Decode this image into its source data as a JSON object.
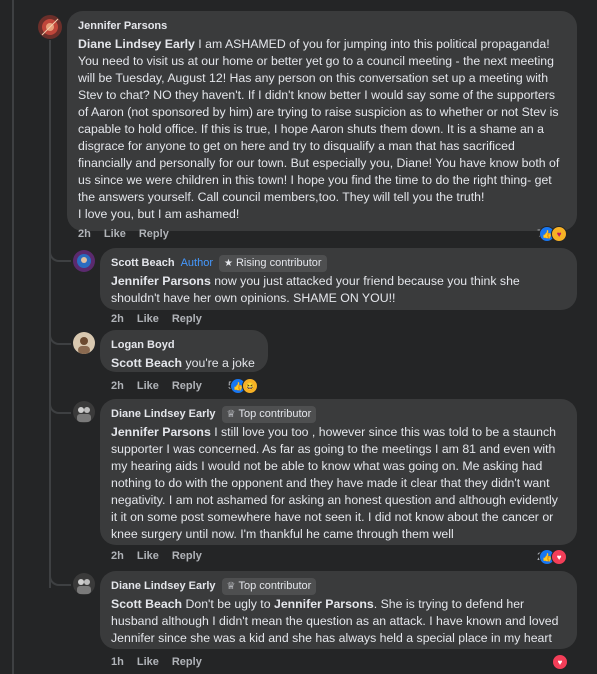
{
  "comments": [
    {
      "author": "Jennifer Parsons",
      "segments": [
        {
          "t": "Diane Lindsey Early",
          "m": true
        },
        {
          "t": " I am ASHAMED of you for jumping into this political propaganda! You need to visit us at our home or better yet go to a council meeting - the next meeting will be Tuesday, August 12! Has any person on this conversation set up a meeting with Stev to chat? NO they haven't. If I didn't know better I would say some of the supporters of Aaron (not sponsored by him) are trying to raise suspicion as to whether or not Stev is capable to hold office. If this is true, I hope Aaron shuts them down. It is a shame an a disgrace for anyone to get on here and try to disqualify a man that has sacrificed financially and personally for our town. But especially you, Diane! You have know both of us since we were children in this town! I hope you find the time to do the right thing- get the answers yourself. Call council members,too. They will tell you the truth!\nI love you, but I am ashamed!",
          "m": false
        }
      ],
      "time": "2h",
      "like": "Like",
      "reply": "Reply",
      "reaction_count": "7",
      "reactions": [
        "like",
        "care"
      ]
    },
    {
      "author": "Scott Beach",
      "author_tag": "Author",
      "badge": "Rising contributor",
      "badge_icon": "star-icon",
      "segments": [
        {
          "t": "Jennifer Parsons",
          "m": true
        },
        {
          "t": " now you just attacked your friend because you think she shouldn't have her own opinions. SHAME ON YOU!!",
          "m": false
        }
      ],
      "time": "2h",
      "like": "Like",
      "reply": "Reply"
    },
    {
      "author": "Logan Boyd",
      "segments": [
        {
          "t": "Scott Beach",
          "m": true
        },
        {
          "t": " you're a joke",
          "m": false
        }
      ],
      "time": "2h",
      "like": "Like",
      "reply": "Reply",
      "reaction_count": "5",
      "reactions": [
        "like",
        "haha"
      ]
    },
    {
      "author": "Diane Lindsey Early",
      "badge": "Top contributor",
      "badge_icon": "award-icon",
      "segments": [
        {
          "t": "Jennifer Parsons",
          "m": true
        },
        {
          "t": " I still love you too , however since this was told to be a staunch supporter I was concerned. As far as going to the meetings I am 81 and even with my hearing aids I would not be able to know what was going on. Me asking had nothing to do with the opponent and they have made it clear that they didn't want negativity. I am not ashamed for asking an honest question and although evidently it it on some post somewhere have not seen it. I did not know about the cancer or knee surgery until now. I'm thankful he came through them well",
          "m": false
        }
      ],
      "time": "2h",
      "like": "Like",
      "reply": "Reply",
      "reaction_count": "2",
      "reactions": [
        "like",
        "love"
      ]
    },
    {
      "author": "Diane Lindsey Early",
      "badge": "Top contributor",
      "badge_icon": "award-icon",
      "segments": [
        {
          "t": "Scott Beach",
          "m": true
        },
        {
          "t": " Don't be ugly to ",
          "m": false
        },
        {
          "t": "Jennifer Parsons",
          "m": true
        },
        {
          "t": ". She is trying to defend her husband although I didn't mean the question as an attack. I have known and loved Jennifer since she was a kid and she has always held a special place in my heart",
          "m": false
        }
      ],
      "time": "1h",
      "like": "Like",
      "reply": "Reply",
      "reaction_count": "",
      "reactions": [
        "love"
      ]
    }
  ],
  "colors": {
    "background": "#242526",
    "bubble": "#3a3b3c",
    "author_tag": "#4599ff",
    "like": "#1877f2",
    "love": "#f33e58"
  }
}
